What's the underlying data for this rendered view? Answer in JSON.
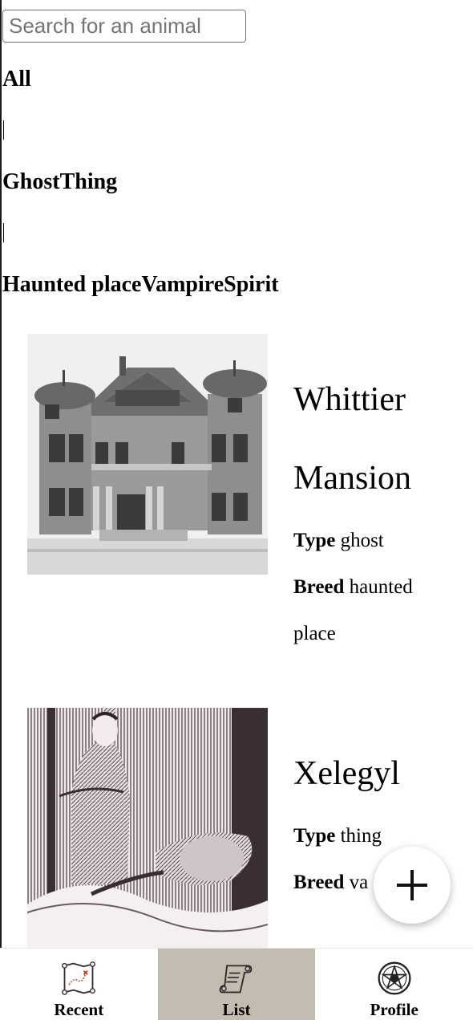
{
  "search": {
    "placeholder": "Search for an animal",
    "value": ""
  },
  "filters": {
    "all": "All",
    "separator": "|",
    "types": "GhostThing",
    "breeds": "Haunted placeVampireSpirit"
  },
  "animals": [
    {
      "name": "Whittier Mansion",
      "type_label": "Type",
      "type": "ghost",
      "breed_label": "Breed",
      "breed": "haunted place",
      "image": "victorian-mansion-photo"
    },
    {
      "name": "Xelegyl",
      "type_label": "Type",
      "type": "thing",
      "breed_label": "Breed",
      "breed": "va",
      "image": "vampire-engraving"
    }
  ],
  "fab": {
    "icon": "plus-icon"
  },
  "nav": {
    "items": [
      {
        "label": "Recent",
        "icon": "treasure-map-icon",
        "active": false
      },
      {
        "label": "List",
        "icon": "scroll-icon",
        "active": true
      },
      {
        "label": "Profile",
        "icon": "pentagram-icon",
        "active": false
      }
    ]
  }
}
